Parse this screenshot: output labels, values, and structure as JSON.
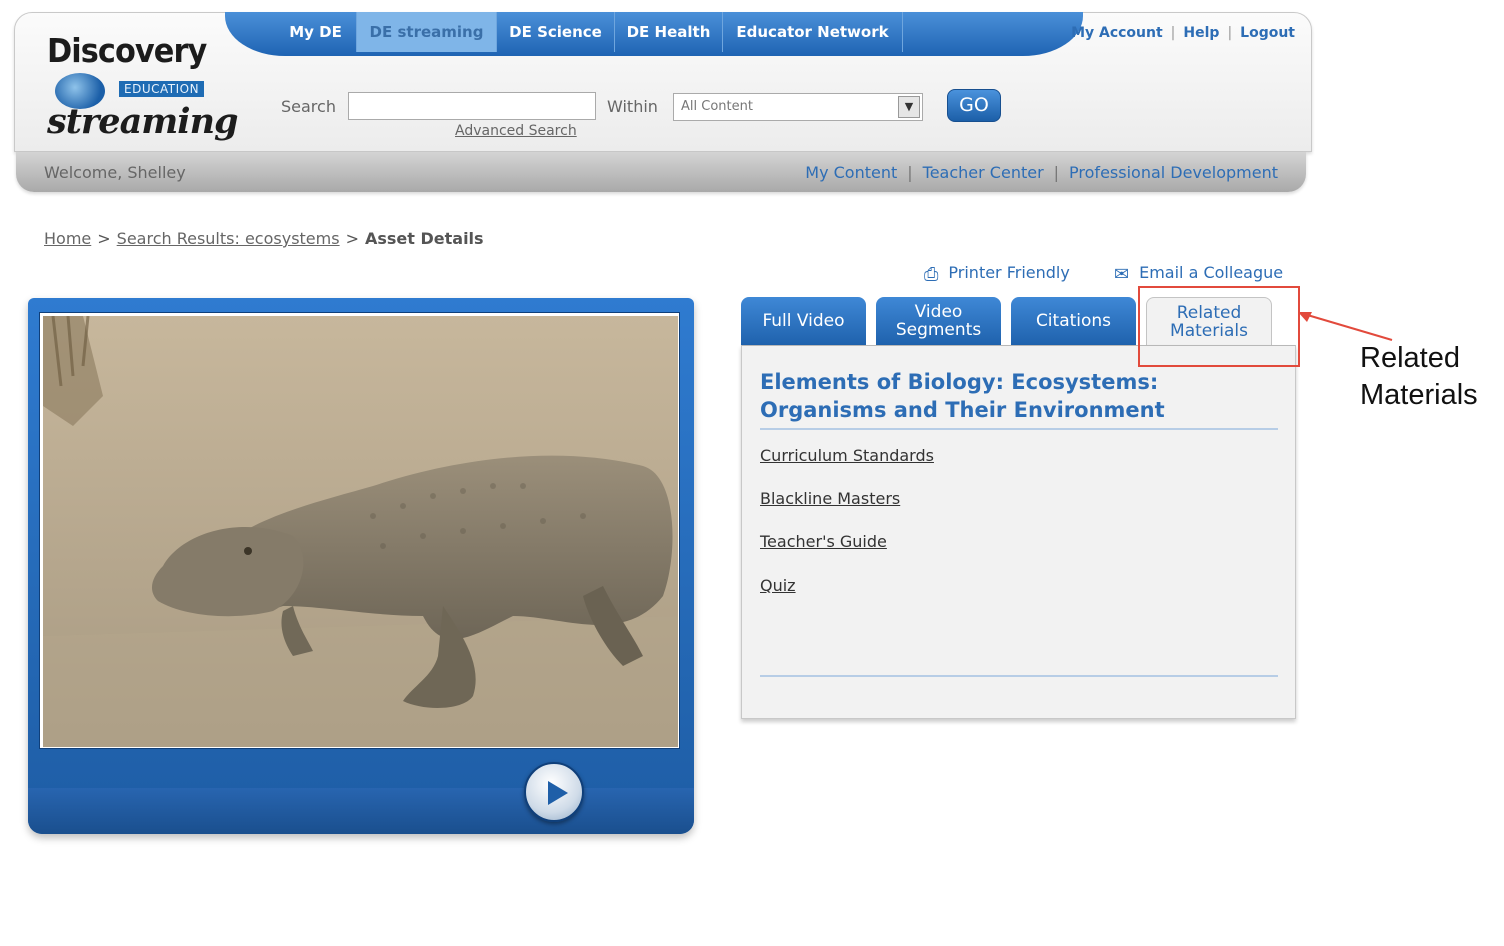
{
  "logo": {
    "top": "Discovery",
    "edu": "EDUCATION",
    "bottom": "streaming"
  },
  "topnav": [
    "My DE",
    "DE streaming",
    "DE Science",
    "DE Health",
    "Educator Network"
  ],
  "account_links": {
    "my_account": "My Account",
    "help": "Help",
    "logout": "Logout",
    "separator": "|"
  },
  "search": {
    "label": "Search",
    "value": "",
    "within_label": "Within",
    "within_value": "All Content",
    "go_label": "GO",
    "advanced": "Advanced Search"
  },
  "subbar": {
    "welcome": "Welcome, Shelley",
    "links": [
      "My Content",
      "Teacher Center",
      "Professional Development"
    ],
    "separator": "|"
  },
  "breadcrumb": {
    "home": "Home",
    "results": "Search Results: ecosystems",
    "current": "Asset Details",
    "separator": ">"
  },
  "tools": {
    "printer": "Printer Friendly",
    "email": "Email a Colleague"
  },
  "tabs": [
    "Full Video",
    "Video Segments",
    "Citations",
    "Related Materials"
  ],
  "asset": {
    "title": "Elements of Biology: Ecosystems: Organisms and Their Environment",
    "materials": [
      "Curriculum Standards",
      "Blackline Masters",
      "Teacher's Guide",
      "Quiz"
    ]
  },
  "annotation": {
    "label_line1": "Related",
    "label_line2": "Materials",
    "color": "#e24a3c"
  },
  "colors": {
    "brand_blue": "#1f64b3",
    "link_blue": "#2d6db5"
  }
}
